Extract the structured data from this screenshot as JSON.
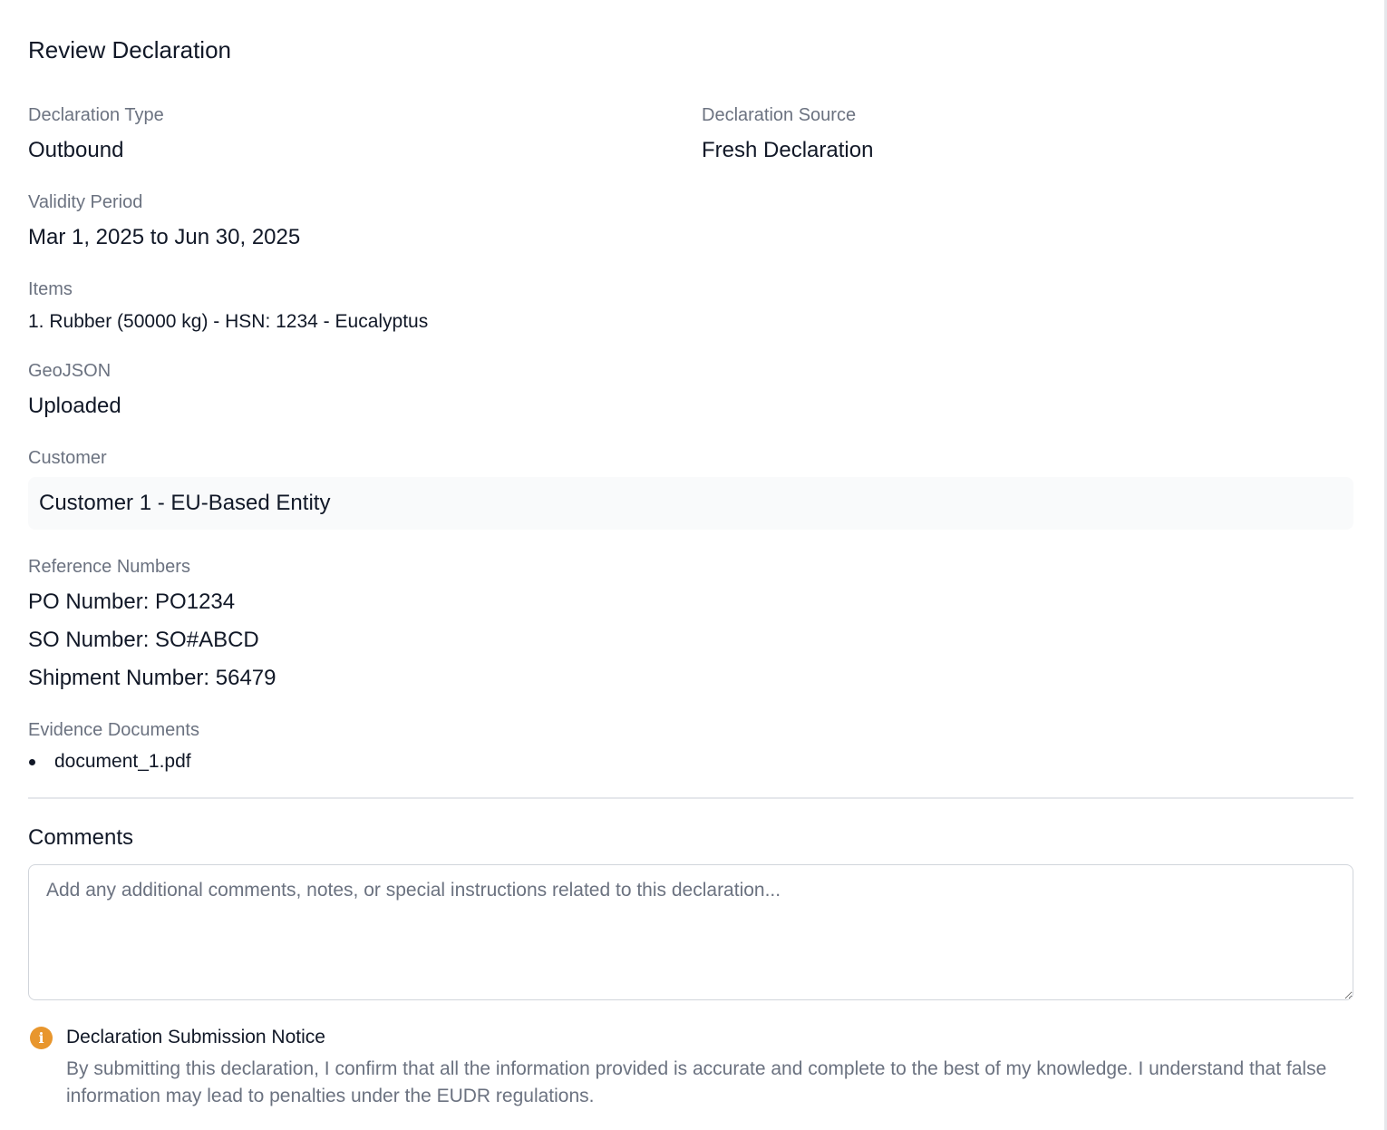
{
  "review": {
    "title": "Review Declaration",
    "declaration_type": {
      "label": "Declaration Type",
      "value": "Outbound"
    },
    "declaration_source": {
      "label": "Declaration Source",
      "value": "Fresh Declaration"
    },
    "validity_period": {
      "label": "Validity Period",
      "value": "Mar 1, 2025 to Jun 30, 2025"
    },
    "items": {
      "label": "Items",
      "list": [
        "1. Rubber (50000 kg) - HSN: 1234 - Eucalyptus"
      ]
    },
    "geojson": {
      "label": "GeoJSON",
      "value": "Uploaded"
    },
    "customer": {
      "label": "Customer",
      "value": "Customer 1 - EU-Based Entity"
    },
    "reference_numbers": {
      "label": "Reference Numbers",
      "list": [
        "PO Number: PO1234",
        "SO Number: SO#ABCD",
        "Shipment Number: 56479"
      ]
    },
    "evidence_documents": {
      "label": "Evidence Documents",
      "list": [
        "document_1.pdf"
      ]
    }
  },
  "comments": {
    "title": "Comments",
    "value": "",
    "placeholder": "Add any additional comments, notes, or special instructions related to this declaration..."
  },
  "notice": {
    "icon": "info-icon",
    "icon_glyph": "i",
    "icon_color": "#e8962d",
    "title": "Declaration Submission Notice",
    "text": "By submitting this declaration, I confirm that all the information provided is accurate and complete to the best of my knowledge. I understand that false information may lead to penalties under the EUDR regulations."
  }
}
